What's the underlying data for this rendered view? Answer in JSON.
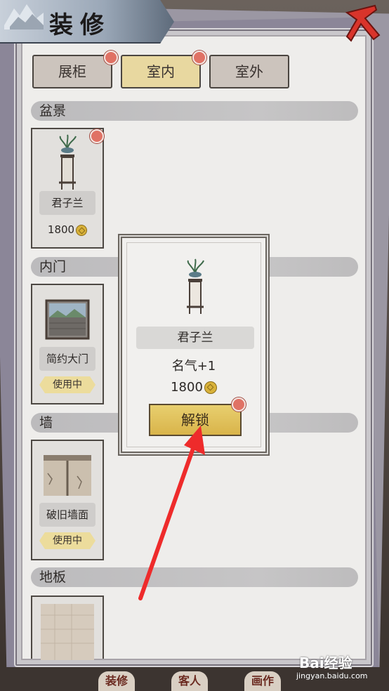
{
  "title": "装修",
  "tabs": [
    {
      "label": "展柜",
      "active": false,
      "badge": true
    },
    {
      "label": "室内",
      "active": true,
      "badge": true
    },
    {
      "label": "室外",
      "active": false,
      "badge": false
    }
  ],
  "sections": [
    {
      "label": "盆景"
    },
    {
      "label": "内门"
    },
    {
      "label": "墙"
    },
    {
      "label": "地板"
    }
  ],
  "items": {
    "bonsai": {
      "name": "君子兰",
      "price": "1800",
      "badge": true
    },
    "door": {
      "name": "简约大门",
      "status": "使用中"
    },
    "wall": {
      "name": "破旧墙面",
      "status": "使用中"
    }
  },
  "popup": {
    "name": "君子兰",
    "effect": "名气+1",
    "price": "1800",
    "button_label": "解锁"
  },
  "bottom_nav": [
    "装修",
    "客人",
    "画作"
  ],
  "watermark": {
    "brand": "Bai经验",
    "url": "jingyan.baidu.com"
  },
  "colors": {
    "accent_gold": "#d9b44a",
    "badge_red": "#e07265",
    "arrow_red": "#ee2b2b"
  }
}
